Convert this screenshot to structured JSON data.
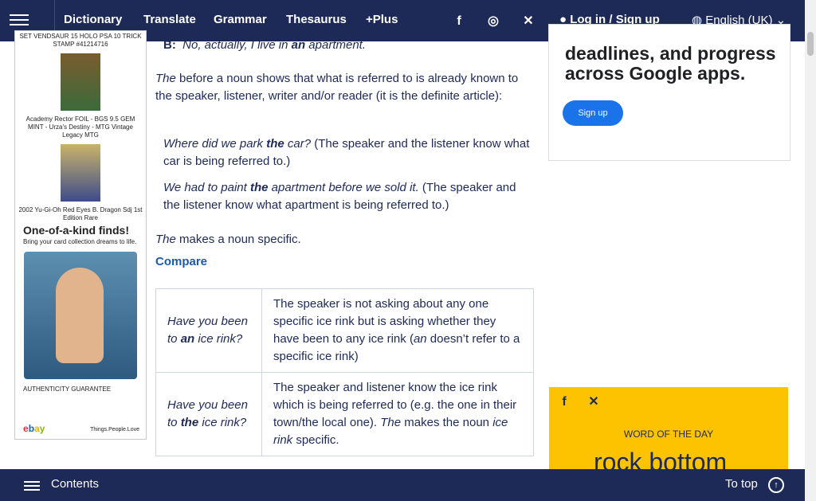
{
  "topbar": {
    "nav": [
      {
        "label": "Dictionary"
      },
      {
        "label": "Translate"
      },
      {
        "label": "Grammar"
      },
      {
        "label": "Thesaurus"
      },
      {
        "label": "+Plus"
      }
    ],
    "social": [
      "facebook-icon",
      "instagram-icon",
      "x-icon"
    ],
    "login": "Log in",
    "signup": "Sign up",
    "language": "English (UK)"
  },
  "leftad": {
    "item1_caption": "SET VENDSAUR 15 HOLO PSA 10 TRICK STAMP #41214716",
    "item2_caption": "Academy Rector FOIL - BGS 9.5 GEM MINT - Urza's Destiny - MTG Vintage Legacy MTG",
    "item3_caption": "2002 Yu-Gi-Oh Red Eyes B. Dragon Sdj 1st Edition Rare",
    "headline": "One-of-a-kind finds!",
    "sub": "Bring your card collection dreams to life.",
    "auth": "AUTHENTICITY GUARANTEE",
    "tagline": "Things.People.Love"
  },
  "content": {
    "b_label": "B:",
    "b_line_pre": "No, actually, I live in ",
    "b_line_bold": "an",
    "b_line_post": " apartment.",
    "p1_the": "The",
    "p1_rest": " before a noun shows that what is referred to is already known to the speaker, listener, writer and/or reader (it is the definite article):",
    "ex1_pre": "Where did we park ",
    "ex1_bold": "the",
    "ex1_post": " car?",
    "ex1_note": " (The speaker and the listener know what car is being referred to.)",
    "ex2_pre": "We had to paint ",
    "ex2_bold": "the",
    "ex2_post": " apartment before we sold it.",
    "ex2_note": " (The speaker and the listener know what apartment is being referred to.)",
    "p2_the": "The",
    "p2_rest": " makes a noun specific.",
    "compare": "Compare",
    "row1_left_pre": "Have you been to ",
    "row1_left_bold": "an",
    "row1_left_post": " ice rink?",
    "row1_right_pre": "The speaker is not asking about any one specific ice rink but is asking whether they have been to any ice rink (",
    "row1_right_it": "an",
    "row1_right_post": " doesn’t refer to a specific ice rink)",
    "row2_left_pre": "Have you been to ",
    "row2_left_bold": "the",
    "row2_left_post": " ice rink?",
    "row2_right_pre": "The speaker and listener know the ice rink which is being referred to (e.g. the one in their town/the local one). ",
    "row2_right_it": "The",
    "row2_right_post": " makes the noun ",
    "row2_right_it2": "ice rink",
    "row2_right_end": " specific."
  },
  "rightad": {
    "headline": "deadlines, and progress across Google apps.",
    "button": "Sign up"
  },
  "wotd": {
    "label": "WORD OF THE DAY",
    "word": "rock bottom"
  },
  "bottombar": {
    "contents": "Contents",
    "totop": "To top"
  }
}
